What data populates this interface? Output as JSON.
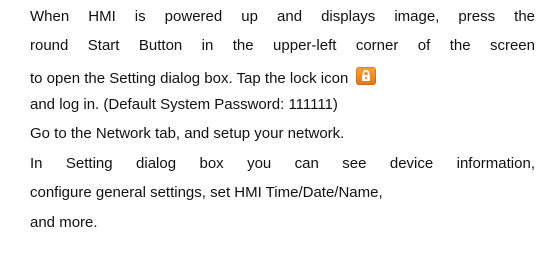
{
  "paragraphs": {
    "p1_line1": "When HMI is powered up and displays image, press the",
    "p1_line2": "round Start Button in the upper-left corner of the screen",
    "p1_line3": "to open the Setting dialog box. Tap the lock icon",
    "p1_line4": "and log in. (Default System Password: 111111)",
    "p2_line1": "Go to the Network tab, and setup your network.",
    "p3_line1": "In Setting dialog box you can see device information,",
    "p3_line2": "configure general settings, set HMI Time/Date/Name,",
    "p3_line3": "and more."
  },
  "icons": {
    "lock": "lock-icon",
    "lock_color": "#f08a1c"
  }
}
